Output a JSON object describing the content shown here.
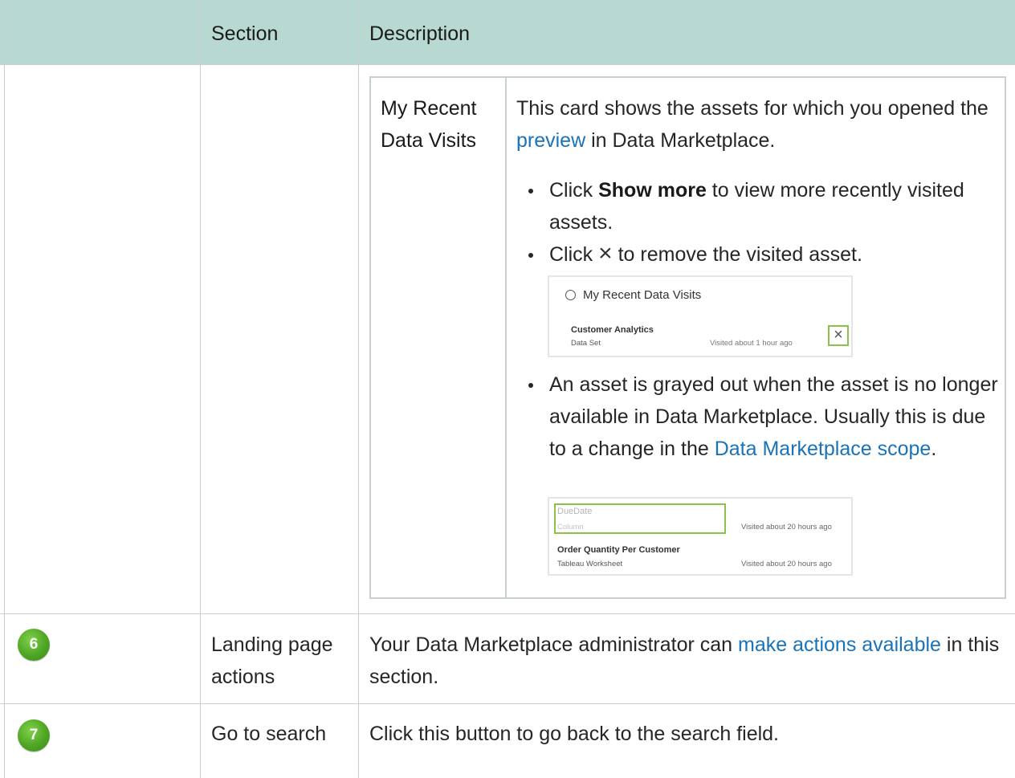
{
  "header": {
    "col_section": "Section",
    "col_description": "Description"
  },
  "recent_visits": {
    "label_line1": "My Recent",
    "label_line2": "Data Visits",
    "desc_part1": "This card shows the assets for which you opened the ",
    "desc_link": "preview",
    "desc_part2": " in Data Marketplace.",
    "bullet1_pre": "Click ",
    "bullet1_bold": "Show more",
    "bullet1_post": " to view more recently visited assets.",
    "bullet2_pre": "Click ",
    "bullet2_icon": "×",
    "bullet2_post": " to remove the visited asset.",
    "bullet3_text": "An asset is grayed out when the asset is no longer available in Data Marketplace. Usually this is due to a change in the ",
    "bullet3_link": "Data Marketplace scope",
    "bullet3_end": ".",
    "shot1": {
      "title": "My Recent Data Visits",
      "asset_name": "Customer Analytics",
      "asset_type": "Data Set",
      "visited": "Visited about 1 hour ago",
      "close_glyph": "×"
    },
    "shot2": {
      "asset1_name": "DueDate",
      "asset1_type": "Column",
      "asset1_visited": "Visited about 20 hours ago",
      "asset2_name": "Order Quantity Per Customer",
      "asset2_type": "Tableau Worksheet",
      "asset2_visited": "Visited about 20 hours ago"
    }
  },
  "rows": [
    {
      "badge": "6",
      "section_line1": "Landing page",
      "section_line2": "actions",
      "desc_part1": "Your Data Marketplace administrator can ",
      "desc_link": "make actions available",
      "desc_part2": " in this section."
    },
    {
      "badge": "7",
      "section": "Go to search",
      "desc": "Click this button to go back to the search field."
    }
  ],
  "colors": {
    "header_bg": "#b8d8d2",
    "link": "#1a73b8",
    "badge": "#4ea524",
    "highlight": "#8bc34a"
  }
}
